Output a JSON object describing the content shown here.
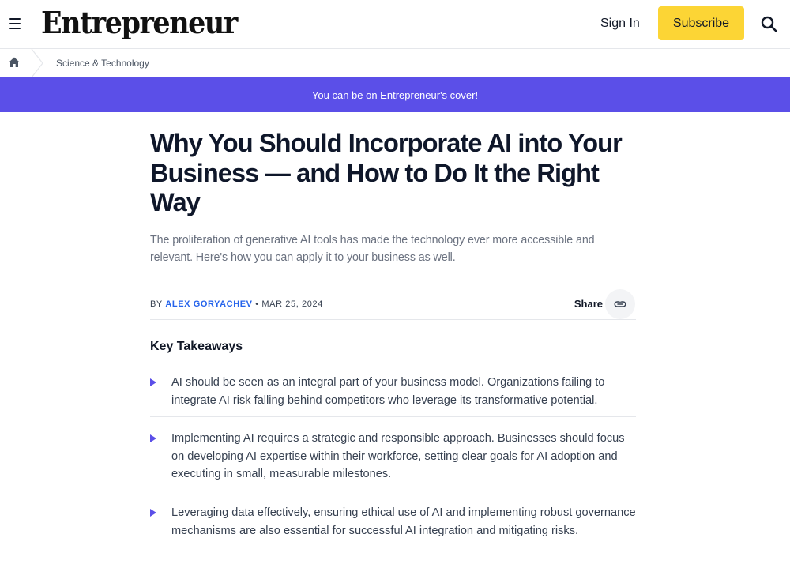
{
  "header": {
    "logo_text": "Entrepreneur",
    "sign_in_label": "Sign In",
    "subscribe_label": "Subscribe"
  },
  "breadcrumb": {
    "category": "Science & Technology"
  },
  "promo": {
    "text": "You can be on Entrepreneur's cover!"
  },
  "article": {
    "headline": "Why You Should Incorporate AI into Your Business — and How to Do It the Right Way",
    "dek": "The proliferation of generative AI tools has made the technology ever more accessible and relevant. Here's how you can apply it to your business as well.",
    "by_label": "BY",
    "author": "ALEX GORYACHEV",
    "date": "MAR 25, 2024",
    "share_label": "Share"
  },
  "takeaways": {
    "title": "Key Takeaways",
    "items": [
      "AI should be seen as an integral part of your business model. Organizations failing to integrate AI risk falling behind competitors who leverage its transformative potential.",
      "Implementing AI requires a strategic and responsible approach. Businesses should focus on developing AI expertise within their workforce, setting clear goals for AI adoption and executing in small, measurable milestones.",
      "Leveraging data effectively, ensuring ethical use of AI and implementing robust governance mechanisms are also essential for successful AI integration and mitigating risks."
    ]
  },
  "colors": {
    "brand_purple": "#5b4fe8",
    "subscribe_yellow": "#fcd535",
    "author_link": "#2563eb"
  },
  "icons": {
    "menu": "hamburger-icon",
    "search": "search-icon",
    "home": "home-icon",
    "share": "link-icon",
    "bullet": "triangle-bullet-icon"
  }
}
